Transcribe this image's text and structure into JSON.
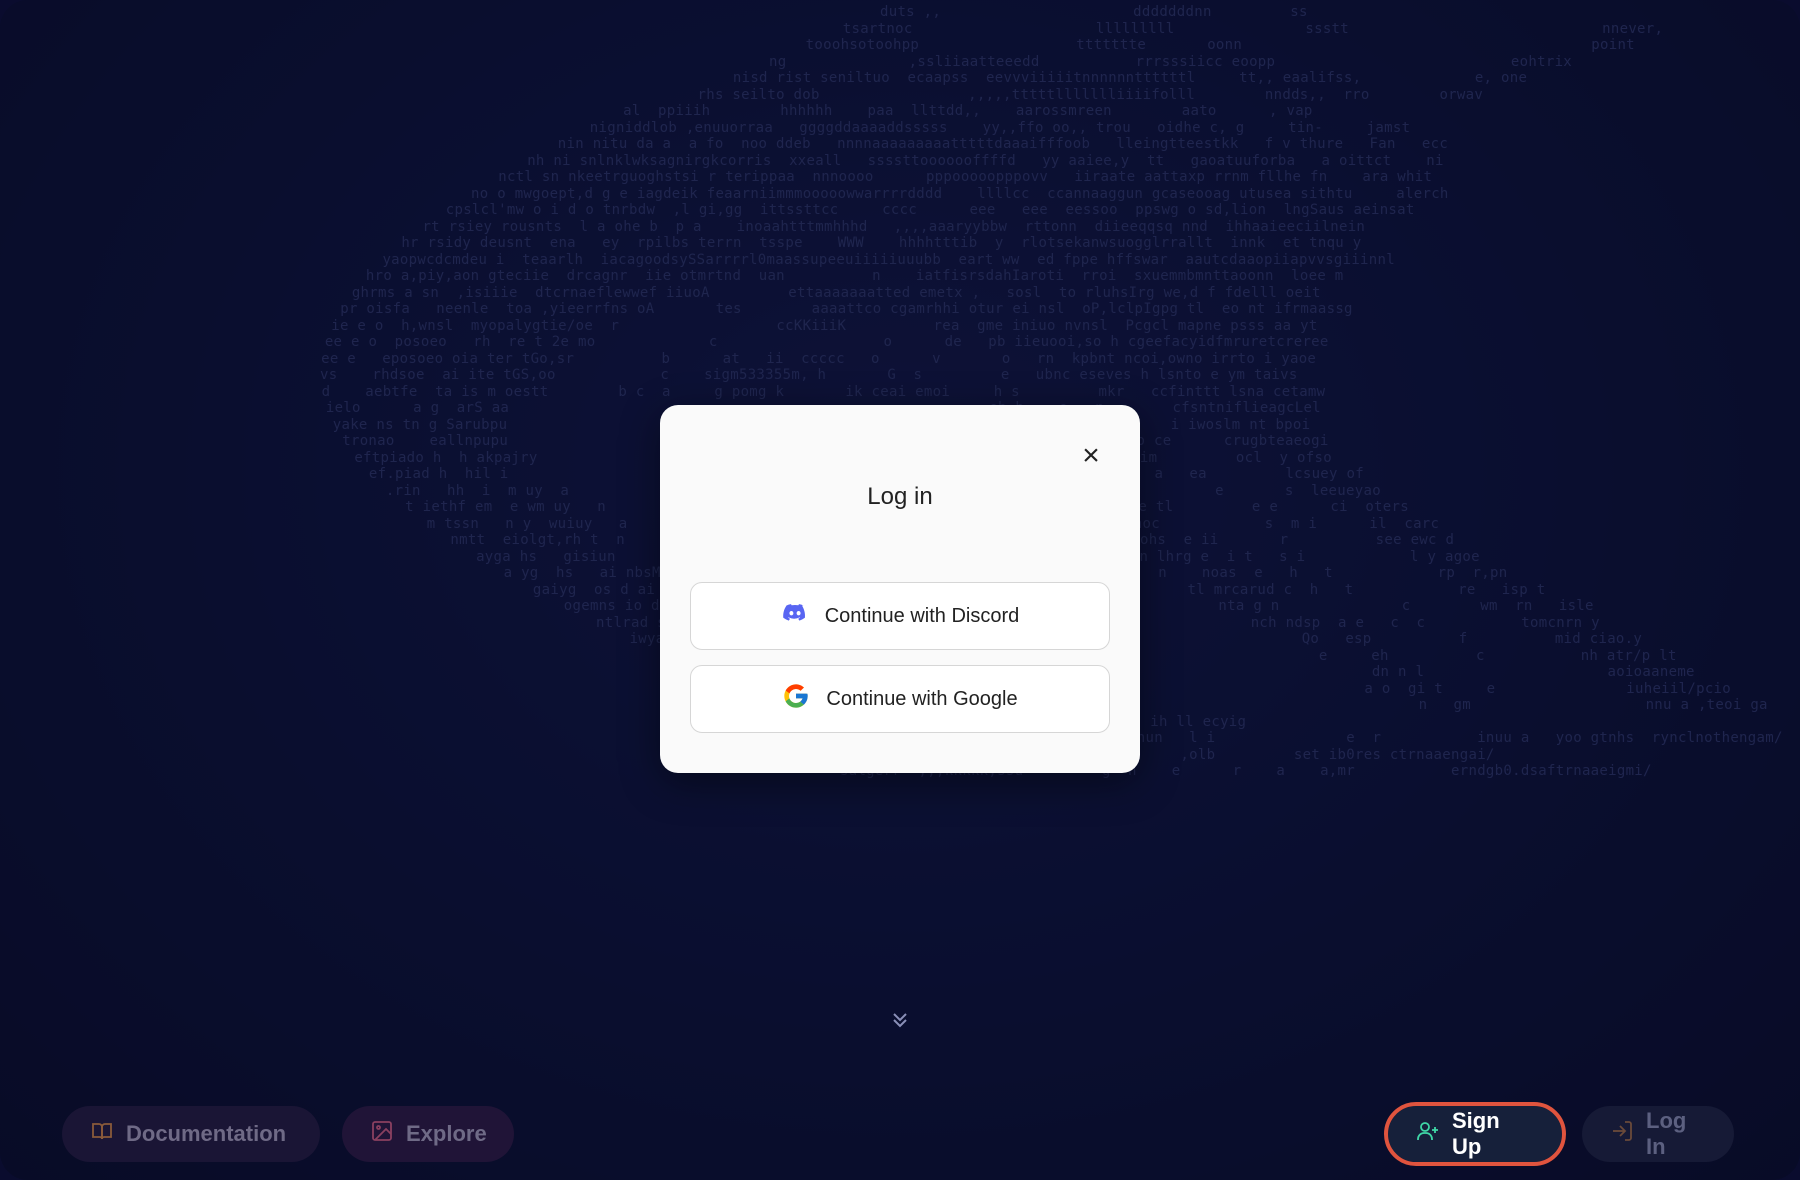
{
  "modal": {
    "title": "Log in",
    "close_glyph": "×",
    "buttons": [
      {
        "label": "Continue with Discord",
        "icon": "discord-icon"
      },
      {
        "label": "Continue with Google",
        "icon": "google-icon"
      }
    ]
  },
  "bottom_nav": {
    "documentation": "Documentation",
    "explore": "Explore",
    "signup": "Sign Up",
    "login": "Log In"
  },
  "background": {
    "ascii_lines": [
      "duts ,,                      dddddddnn         ss",
      "tsartnoc                     lllllllll               ssstt                             nnever,",
      "tooohsotoohpp                  ttttttte       oonn                                        point",
      "ng              ,ssliiaatteeedd           rrrsssiicc eoopp                           eohtrix",
      "nisd rist seniltuo  ecaapss  eevvviiiiitnnnnnnttttttl     tt,, eaalifss,             e, one",
      "rhs seilto dob                 ,,,,,tttttllllllliiiifolll        nndds,,  rro        orwav",
      "al  ppiiih        hhhhhh    paa  llttdd,,    aarossmreen        aato      , vap",
      "nigniddlob ,enuuorraa   ggggddaaaaddsssss    yy,,ffo oo,, trou   oidhe c, g     tin-     jamst",
      "nin nitu da a  a fo  noo ddeb   nnnnaaaaaaaaatttttdaaaifffoob   lleingtteestkk   f v thure   Fan   ecc",
      "nh ni snlnklwksagnirgkcorris  xxeall   ssssttooooooffffd   yy aaiee,y  tt   gaoatuuforba   a oittct    ni",
      "nctl sn nkeetrguoghstsi r terippaa  nnnoooo      pppooooopppovv   iiraate aattaxp rrnm fllhe fn    ara whit",
      "no o mwgoept,d g e iagdeik feaarniimmmooooowwarrrrdddd    llllcc  ccannaaggun gcaseooag utusea sithtu     alerch",
      "cpslcl'mw o i d o tnrbdw  ,l gi,gg  ittssttcc     cccc      eee   eee  eessoo  ppswg o sd,lion  lngSaus aeinsat",
      "rt rsiey rousnts  l a ohe b  p a    inoaahtttmmhhhd   ,,,,aaaryybbw  rttonn  diieeqqsq nnd  ihhaaieeciilnein",
      "hr rsidy deusnt  ena   ey  rpilbs terrn  tsspe    WWW    hhhhtttib  y  rlotsekanwsuogglrrallt  innk  et tnqu y",
      "yaopwcdcmdeu i  teaarlh  iacagoodsySSarrrrl0maassupeeuiiiiiuuubb  eart ww  ed fppe hffswar  aautcdaaopiiapvvsgiiinnl",
      "hro a,piy,aon gteciie  drcagnr  iie otmrtnd  uan          n    iatfisrsdahIaroti  rroi  sxuemmbmnttaoonn  loee m",
      "ghrms a sn  ,isiiie  dtcrnaeflewwef iiuoA         ettaaaaaaatted emetx ,   sosl  to rluhsIrg we,d f fdelll oeit",
      "pr oisfa   neenle  toa ,yieerrfns oA       tes        aaaattco cgamrhhi otur ei nsl  oP,lclpIgpg tl  eo nt ifrmaassg",
      "ie e o  h,wnsl  myopalygtie/oe  r                  ccKKiiiK          rea  gme iniuo nvnsl  Pcgcl mapne psss aa yt",
      "ee e o  posoeo   rh  re t 2e mo             c                   o      de   pb iieuooi,so h cgeefacyidfmruretcreree",
      "ee e   eposoeo oia ter tGo,sr          b      at   ii  ccccc   o      v       o   rn  kpbnt ncoi,owno irrto i yaoe",
      "vs    rhdsoe  ai ite tGS,oo            c    sigm533355m, h       G  s         e   ubnc eseves h lsnto e ym taivs",
      "d    aebtfe  ta is m oestt        b c  a     g pomg k       ik ceai emoi     h s         mkr   ccfinttt lsna cetamw",
      "ielo      a g  arS aa                                                       eh h    e   r        cfsntniflieagcLel",
      "yake ns tn g Sarubpu                                                        h    a  l           i iwoslm nt bpoi",
      "tronao    eallnpupu                                                        ttc   abo    a  o ce      crugbteaeogi",
      "eftpiado h  h akpajry                                                      iieot    t   u im         ocl  y ofso",
      "ef.piad h  hil i                                                           nl sneh al     a   ea         lcsuey of",
      ".rin   hh  i  m uy  a                                                      e dtrhih al         e       s  leeueyao",
      "t iethf em  e wm uy   n                                                    e eaehsnee tl         e e      ci  oters",
      "m tssn   n y  wuiuy   a                                                      m daaoc            s  m i      il  carc",
      "nmtt  eiolgt,rh t  n                                                       mheaohs  e ii       r          see ewc d",
      "ayga hs   gisiun                                                           hn lhrg e  i t   s i            l y agoe",
      "a yg  hs   ai nbsM n s                                                     n    noas  e   h   t            rp  r,pn",
      "gaiyg  os d ai nbn  a                                                      tl mrcarud c  h   t            re   isp t",
      "ogemns io d e  ;nethr                                                      nta g n              c        wm  rn   isle",
      "ntlrad s  o  e  nt   oer                                                   nch ndsp  a e   c  c           tomcnrn y",
      "iwyavegu eo ak tny  e                                                        Qo   esp          f          mid ciao.y",
      "hwyivea   ma t tt                                                          e     eh          c           nh atr/p lt",
      "ia tlsti   ,a t                                                              dn n l                     aoioaaneme",
      "irs        n                                                            a o  gi t     e               iuheiil/pcio",
      "tt oa                                                                     n   gm                    nnu a ,teoi ga",
      "hm  o      y  ,          inuu a ,tomng ih ll ecyig",
      "noiiattssssssstta              ce nun   l i               e  r           inuu a   yoo gtnhs  rynclnothengam/",
      "lleb  bld     n o  l      ,      e     ,olb         set ib0res ctrnaaengai/",
      "salgerr  ,,,kkkkk,ssu         g  n    e      r    a    a,mr           erndgb0.dsaftrnaaeigmi/"
    ]
  }
}
